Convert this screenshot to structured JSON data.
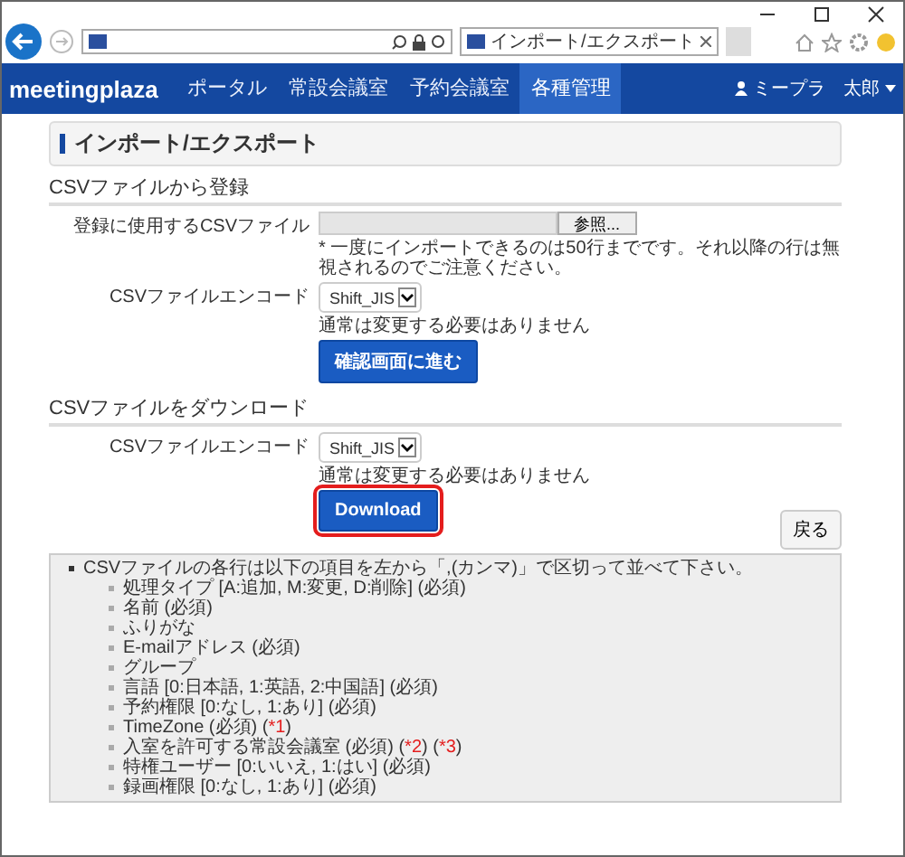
{
  "browser": {
    "tab_title": "インポート/エクスポート"
  },
  "nav": {
    "logo": "meetingplaza",
    "items": [
      {
        "label": "ポータル",
        "selected": false
      },
      {
        "label": "常設会議室",
        "selected": false
      },
      {
        "label": "予約会議室",
        "selected": false
      },
      {
        "label": "各種管理",
        "selected": true
      }
    ],
    "user": "ミープラ",
    "user_menu": "太郎"
  },
  "page_title": "インポート/エクスポート",
  "import_section": {
    "heading": "CSVファイルから登録",
    "file_label": "登録に使用するCSVファイル",
    "browse_button": "参照...",
    "file_note": "* 一度にインポートできるのは50行までです。それ以降の行は無視されるのでご注意ください。",
    "encode_label": "CSVファイルエンコード",
    "encode_value": "Shift_JIS",
    "encode_note": "通常は変更する必要はありません",
    "submit_button": "確認画面に進む"
  },
  "download_section": {
    "heading": "CSVファイルをダウンロード",
    "encode_label": "CSVファイルエンコード",
    "encode_value": "Shift_JIS",
    "encode_note": "通常は変更する必要はありません",
    "download_button": "Download",
    "download_highlighted": true
  },
  "back_button": "戻る",
  "help": {
    "intro": "CSVファイルの各行は以下の項目を左から「,(カンマ)」で区切って並べて下さい。",
    "items": [
      [
        {
          "text": "処理タイプ [A:追加, M:変更, D:削除] (必須)"
        }
      ],
      [
        {
          "text": "名前 (必須)"
        }
      ],
      [
        {
          "text": "ふりがな"
        }
      ],
      [
        {
          "text": "E-mailアドレス (必須)"
        }
      ],
      [
        {
          "text": "グループ"
        }
      ],
      [
        {
          "text": "言語 [0:日本語, 1:英語, 2:中国語] (必須)"
        }
      ],
      [
        {
          "text": "予約権限 [0:なし, 1:あり] (必須)"
        }
      ],
      [
        {
          "text": "TimeZone (必須) ("
        },
        {
          "text": "*1",
          "kind": "note"
        },
        {
          "text": ")"
        }
      ],
      [
        {
          "text": "入室を許可する常設会議室 (必須) ("
        },
        {
          "text": "*2",
          "kind": "note"
        },
        {
          "text": ") ("
        },
        {
          "text": "*3",
          "kind": "note"
        },
        {
          "text": ")"
        }
      ],
      [
        {
          "text": "特権ユーザー [0:いいえ, 1:はい] (必須)"
        }
      ],
      [
        {
          "text": "録画権限 [0:なし, 1:あり] (必須)"
        }
      ]
    ]
  }
}
